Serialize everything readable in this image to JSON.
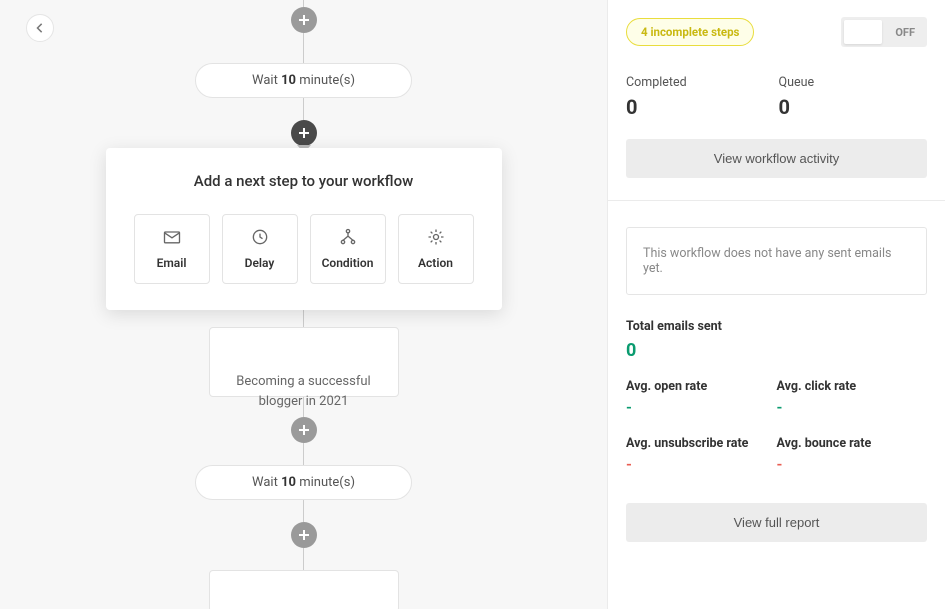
{
  "flow": {
    "wait1": {
      "prefix": "Wait ",
      "value": "10",
      "suffix": " minute(s)"
    },
    "emailCard1": "Becoming a successful blogger in 2021",
    "wait2": {
      "prefix": "Wait ",
      "value": "10",
      "suffix": " minute(s)"
    }
  },
  "popover": {
    "title": "Add a next step to your workflow",
    "options": [
      {
        "label": "Email",
        "icon": "mail-icon"
      },
      {
        "label": "Delay",
        "icon": "clock-icon"
      },
      {
        "label": "Condition",
        "icon": "branch-icon"
      },
      {
        "label": "Action",
        "icon": "gear-icon"
      }
    ]
  },
  "sidebar": {
    "badge": "4 incomplete steps",
    "toggle": "OFF",
    "completed": {
      "label": "Completed",
      "value": "0"
    },
    "queue": {
      "label": "Queue",
      "value": "0"
    },
    "viewActivityBtn": "View workflow activity",
    "notice": "This workflow does not have any sent emails yet.",
    "totalSent": {
      "label": "Total emails sent",
      "value": "0"
    },
    "metrics": [
      {
        "label": "Avg. open rate",
        "value": "-",
        "cls": "green"
      },
      {
        "label": "Avg. click rate",
        "value": "-",
        "cls": "green"
      },
      {
        "label": "Avg. unsubscribe rate",
        "value": "-",
        "cls": "red"
      },
      {
        "label": "Avg. bounce rate",
        "value": "-",
        "cls": "red"
      }
    ],
    "viewReportBtn": "View full report"
  }
}
